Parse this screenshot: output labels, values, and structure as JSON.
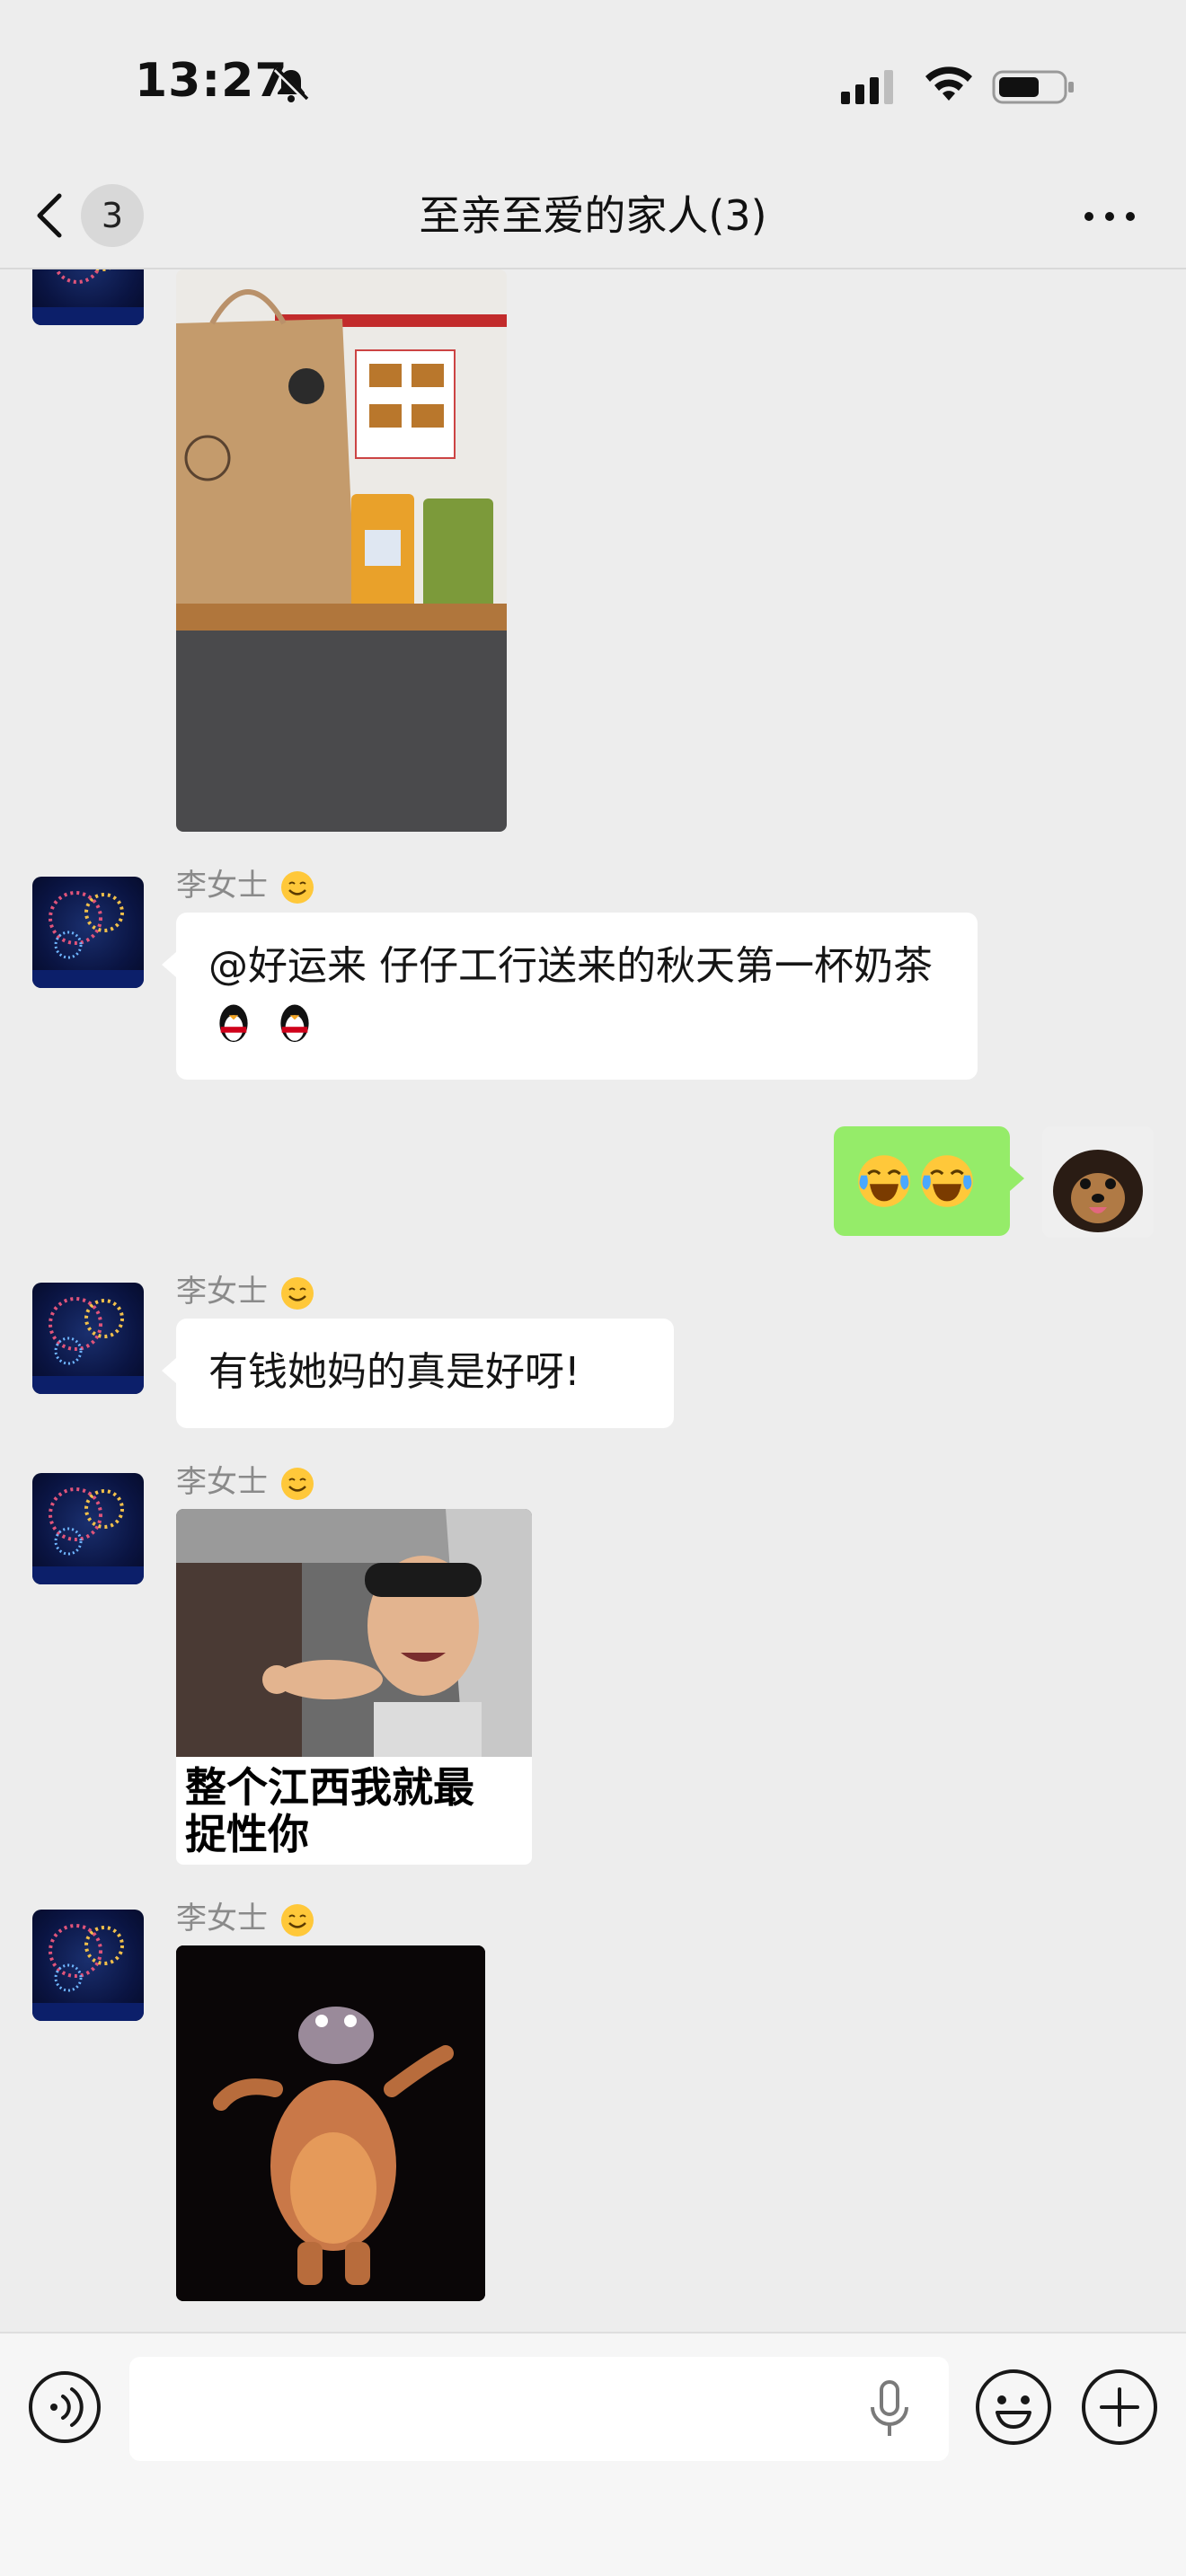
{
  "status": {
    "time": "13:27"
  },
  "nav": {
    "unread_count": "3",
    "title": "至亲至爱的家人(3)"
  },
  "messages": [
    {
      "type": "image",
      "side": "left",
      "description_icon": "shopping-bag-milk-tea-photo"
    },
    {
      "type": "text",
      "side": "left",
      "sender": "李女士",
      "text": "@好运来 仔仔工行送来的秋天第一杯奶茶",
      "trailing_emoji": [
        "penguin-icon",
        "penguin-icon"
      ]
    },
    {
      "type": "emoji",
      "side": "right",
      "emoji": [
        "laugh-cry-icon",
        "laugh-cry-icon"
      ]
    },
    {
      "type": "text",
      "side": "left",
      "sender": "李女士",
      "text": "有钱她妈的真是好呀!"
    },
    {
      "type": "sticker",
      "side": "left",
      "sender": "李女士",
      "caption_line1": "整个江西我就最",
      "caption_line2": "捉性你"
    },
    {
      "type": "sticker",
      "side": "left",
      "sender": "李女士",
      "description_icon": "dancing-hippo-sticker"
    }
  ],
  "colors": {
    "background": "#ededed",
    "bubble_self": "#95ec69",
    "bubble_other": "#ffffff",
    "name_text": "#8a8a8a"
  },
  "icons": {
    "status": [
      "bell-mute-icon",
      "signal-icon",
      "wifi-icon",
      "battery-icon"
    ],
    "nav": [
      "back-chevron-icon",
      "more-icon"
    ],
    "input": [
      "voice-icon",
      "microphone-icon",
      "emoji-icon",
      "plus-icon"
    ]
  }
}
